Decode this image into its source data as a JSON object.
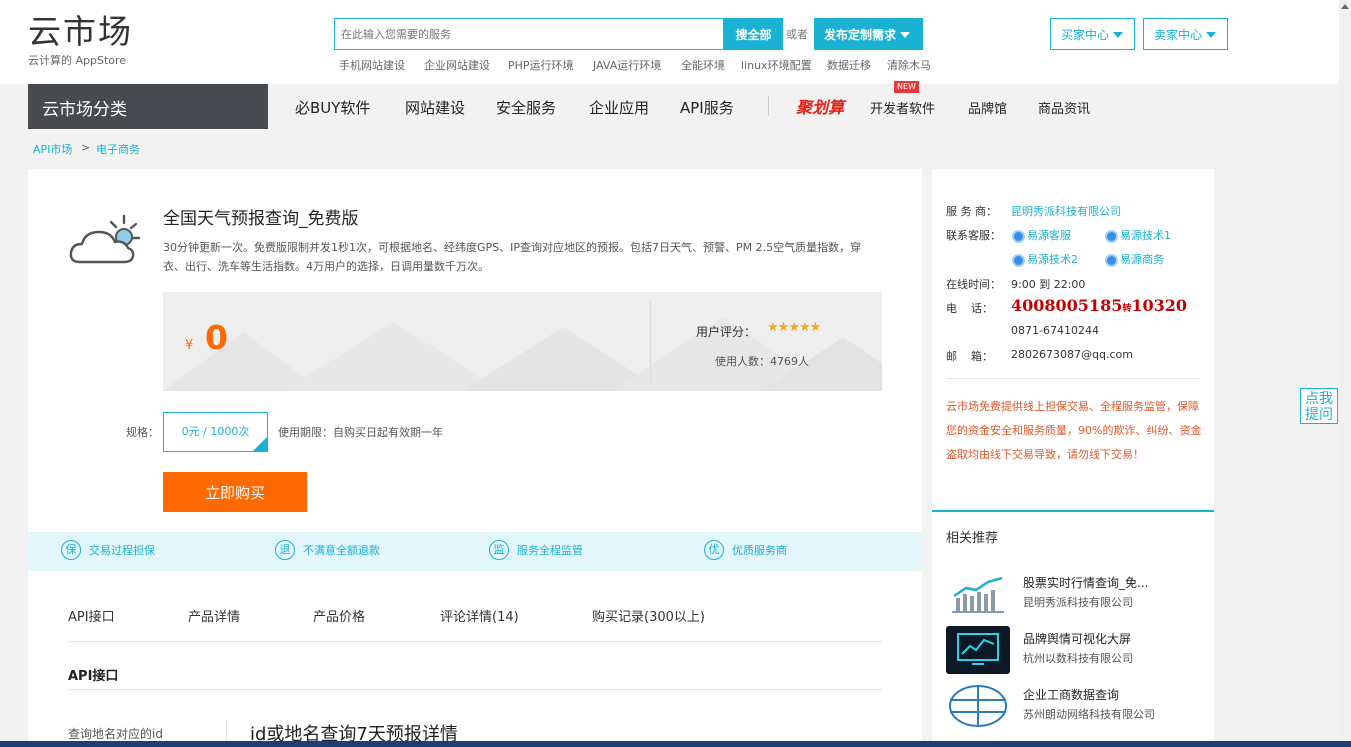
{
  "header": {
    "logo_title": "云市场",
    "logo_sub": "云计算的 AppStore",
    "search_placeholder": "在此输入您需要的服务",
    "search_button": "搜全部",
    "or_text": "或者",
    "publish_button": "发布定制需求",
    "hot_keywords": [
      "手机网站建设",
      "企业网站建设",
      "PHP运行环境",
      "JAVA运行环境",
      "全能环境",
      "linux环境配置",
      "数据迁移",
      "清除木马"
    ],
    "buyer_center": "买家中心",
    "seller_center": "卖家中心"
  },
  "nav": {
    "category": "云市场分类",
    "items": [
      "必BUY软件",
      "网站建设",
      "安全服务",
      "企业应用",
      "API服务"
    ],
    "promo_logo": "聚划算",
    "developer": "开发者软件",
    "new_badge": "NEW",
    "brand": "品牌馆",
    "news": "商品资讯"
  },
  "breadcrumb": {
    "root": "API市场",
    "sep": ">",
    "current": "电子商务"
  },
  "product": {
    "title": "全国天气预报查询_免费版",
    "description": "30分钟更新一次。免费版限制并发1秒1次，可根据地名、经纬度GPS、IP查询对应地区的预报。包括7日天气、预警、PM 2.5空气质量指数，穿衣、出行、洗车等生活指数。4万用户的选择，日调用量数千万次。",
    "price_symbol": "¥",
    "price": "0",
    "rating_label": "用户评分：",
    "rating": 5,
    "stars": "★★★★★",
    "users_label": "使用人数：4769人",
    "spec_label": "规格：",
    "spec_option": "0元 / 1000次",
    "validity": "使用期限：自购买日起有效期一年",
    "buy_button": "立即购买"
  },
  "guarantees": [
    {
      "icon": "保",
      "text": "交易过程担保"
    },
    {
      "icon": "退",
      "text": "不满意全额退款"
    },
    {
      "icon": "监",
      "text": "服务全程监管"
    },
    {
      "icon": "优",
      "text": "优质服务商"
    }
  ],
  "tabs": [
    "API接口",
    "产品详情",
    "产品价格",
    "评论详情(14)",
    "购买记录(300以上)"
  ],
  "api_section": {
    "title": "API接口",
    "left_item": "查询地名对应的id",
    "right_heading": "id或地名查询7天预报详情"
  },
  "provider": {
    "provider_label": "服 务 商：",
    "provider_name": "昆明秀派科技有限公司",
    "cs_label": "联系客服：",
    "cs": [
      "易源客服",
      "易源技术1",
      "易源技术2",
      "易源商务"
    ],
    "hours_label": "在线时间：",
    "hours": "9:00 到 22:00",
    "phone_label": "电    话：",
    "phone_main": "4008005185",
    "phone_ext_label": "转",
    "phone_ext": "10320",
    "phone_alt": "0871-67410244",
    "email_label": "邮    箱：",
    "email": "2802673087@qq.com",
    "notice": "云市场免费提供线上担保交易、全程服务监管，保障您的资金安全和服务质量，90%的欺诈、纠纷、资金盗取均由线下交易导致，请勿线下交易！"
  },
  "recommend": {
    "title": "相关推荐",
    "items": [
      {
        "name": "股票实时行情查询_免...",
        "company": "昆明秀派科技有限公司"
      },
      {
        "name": "品牌舆情可视化大屏",
        "company": "杭州以数科技有限公司"
      },
      {
        "name": "企业工商数据查询",
        "company": "苏州朗动网络科技有限公司"
      }
    ]
  },
  "help_button": "点我提问",
  "colors": {
    "accent": "#1ab2d3",
    "orange": "#ff6a00",
    "phone_red": "#c40000",
    "notice": "#e2582a",
    "nav_dark": "#474a4f"
  }
}
